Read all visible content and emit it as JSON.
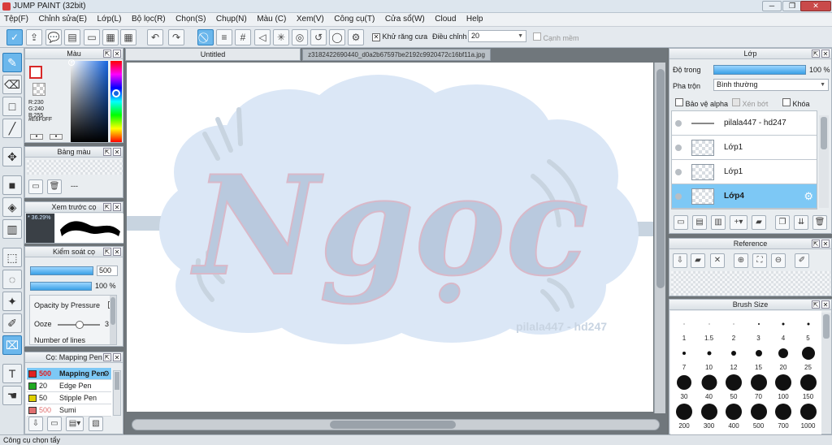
{
  "window": {
    "title": "JUMP PAINT (32bit)",
    "minimize": "─",
    "restore": "❐",
    "close": "✕"
  },
  "menu": [
    "Tệp(F)",
    "Chỉnh sửa(E)",
    "Lớp(L)",
    "Bộ lọc(R)",
    "Chọn(S)",
    "Chụp(N)",
    "Màu (C)",
    "Xem(V)",
    "Công cụ(T)",
    "Cửa sổ(W)",
    "Cloud",
    "Help"
  ],
  "toolbar": {
    "antialias_label": "Khử răng cưa",
    "adjust_label": "Điều chỉnh",
    "adjust_value": "20",
    "edge_label": "Cạnh mềm",
    "antialias_checked": "✕"
  },
  "color_panel": {
    "title": "Màu",
    "r": "R:230",
    "g": "G:240",
    "b": "B:255",
    "hex": "#E6F0FF"
  },
  "palette_panel": {
    "title": "Bảng màu",
    "placeholder": "---"
  },
  "brush_preview": {
    "title": "Xem trước cọ",
    "zoom": "36.29%"
  },
  "brush_control": {
    "title": "Kiểm soát cọ",
    "size_value": "500",
    "opacity_value": "100 %",
    "opacity_by_pressure": "Opacity by Pressure",
    "ooze": "Ooze",
    "ooze_value": "3",
    "number_of_lines": "Number of lines"
  },
  "brush_list": {
    "title": "Cọ: Mapping Pen",
    "items": [
      {
        "size": "500",
        "name": "Mapping Pen",
        "color": "#e02020"
      },
      {
        "size": "20",
        "name": "Edge Pen",
        "color": "#22aa22"
      },
      {
        "size": "50",
        "name": "Stipple Pen",
        "color": "#e0d000"
      },
      {
        "size": "500",
        "name": "Sumi",
        "color": "#e07070"
      }
    ]
  },
  "document": {
    "tab_title": "Untitled",
    "tab2_title": "z3182422690440_d0a2b67597be2192c9920472c16bf11a.jpg",
    "art_text": "Ngọc",
    "watermark": "pilala447 -  hd247"
  },
  "layer_panel": {
    "title": "Lớp",
    "opacity_label": "Độ trong",
    "opacity_value": "100 %",
    "blend_label": "Pha trộn",
    "blend_value": "Bình thường",
    "protect_alpha": "Bảo vệ alpha",
    "clipping": "Xén bớt",
    "lock": "Khóa",
    "layers": [
      {
        "name": "pilala447 -  hd247",
        "selected": false
      },
      {
        "name": "Lớp1",
        "selected": false
      },
      {
        "name": "Lớp1",
        "selected": false
      },
      {
        "name": "Lớp4",
        "selected": true
      }
    ]
  },
  "reference_panel": {
    "title": "Reference"
  },
  "brush_size_panel": {
    "title": "Brush Size",
    "sizes": [
      "1",
      "1.5",
      "2",
      "3",
      "4",
      "5",
      "7",
      "10",
      "12",
      "15",
      "20",
      "25",
      "30",
      "40",
      "50",
      "70",
      "100",
      "150",
      "200",
      "300",
      "400",
      "500",
      "700",
      "1000"
    ]
  },
  "status": "Công cụ chọn tẩy"
}
